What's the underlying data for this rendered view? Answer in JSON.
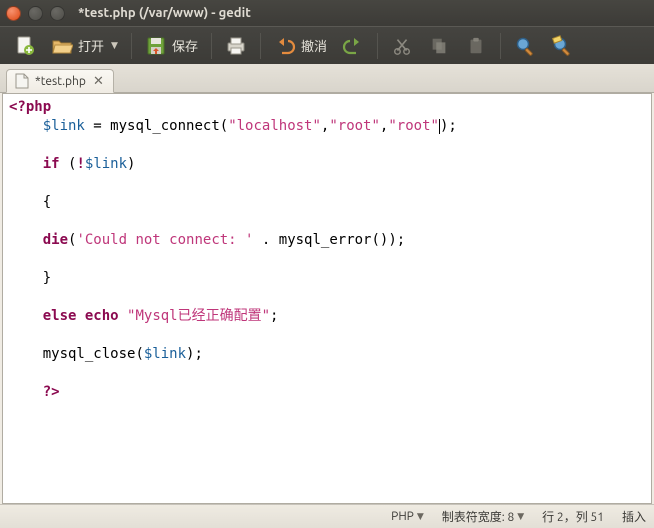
{
  "window": {
    "title": "*test.php (/var/www) - gedit"
  },
  "toolbar": {
    "open_label": "打开",
    "save_label": "保存",
    "undo_label": "撤消"
  },
  "tab": {
    "label": "*test.php"
  },
  "code": {
    "php_open": "<?php",
    "indent": "    ",
    "link_var": "$link",
    "eq": " = ",
    "connect_fn": "mysql_connect",
    "lp": "(",
    "comma": ",",
    "rp": ")",
    "semi": ";",
    "s_host": "\"localhost\"",
    "s_user": "\"root\"",
    "s_pass": "\"root\"",
    "not": "!",
    "if_kw": "if ",
    "lbrace": "{",
    "rbrace": "}",
    "die_fn": "die",
    "s_err": "'Could not connect: '",
    "concat": " . ",
    "errfn": "mysql_error",
    "empty_args": "()",
    "else_kw": "else ",
    "echo_kw": "echo ",
    "s_ok": "\"Mysql已经正确配置\"",
    "close_fn": "mysql_close",
    "php_close": "?>"
  },
  "status": {
    "lang": "PHP",
    "tabwidth_label": "制表符宽度: 8",
    "pos": "行 2，列 51",
    "mode": "插入"
  }
}
